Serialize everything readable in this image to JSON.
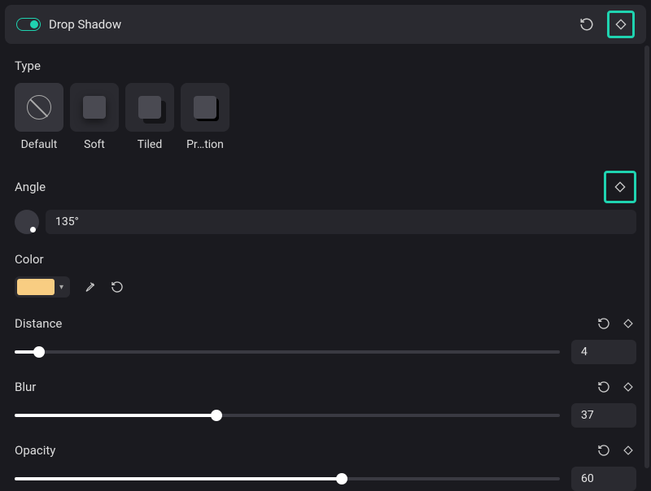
{
  "header": {
    "title": "Drop Shadow"
  },
  "type": {
    "label": "Type",
    "options": [
      {
        "label": "Default"
      },
      {
        "label": "Soft"
      },
      {
        "label": "Tiled"
      },
      {
        "label": "Pr…tion"
      }
    ]
  },
  "angle": {
    "label": "Angle",
    "value": "135°"
  },
  "color": {
    "label": "Color",
    "swatch_hex": "#f8cd82"
  },
  "distance": {
    "label": "Distance",
    "value": "4",
    "percent": 4.5
  },
  "blur": {
    "label": "Blur",
    "value": "37",
    "percent": 37
  },
  "opacity": {
    "label": "Opacity",
    "value": "60",
    "percent": 60
  }
}
